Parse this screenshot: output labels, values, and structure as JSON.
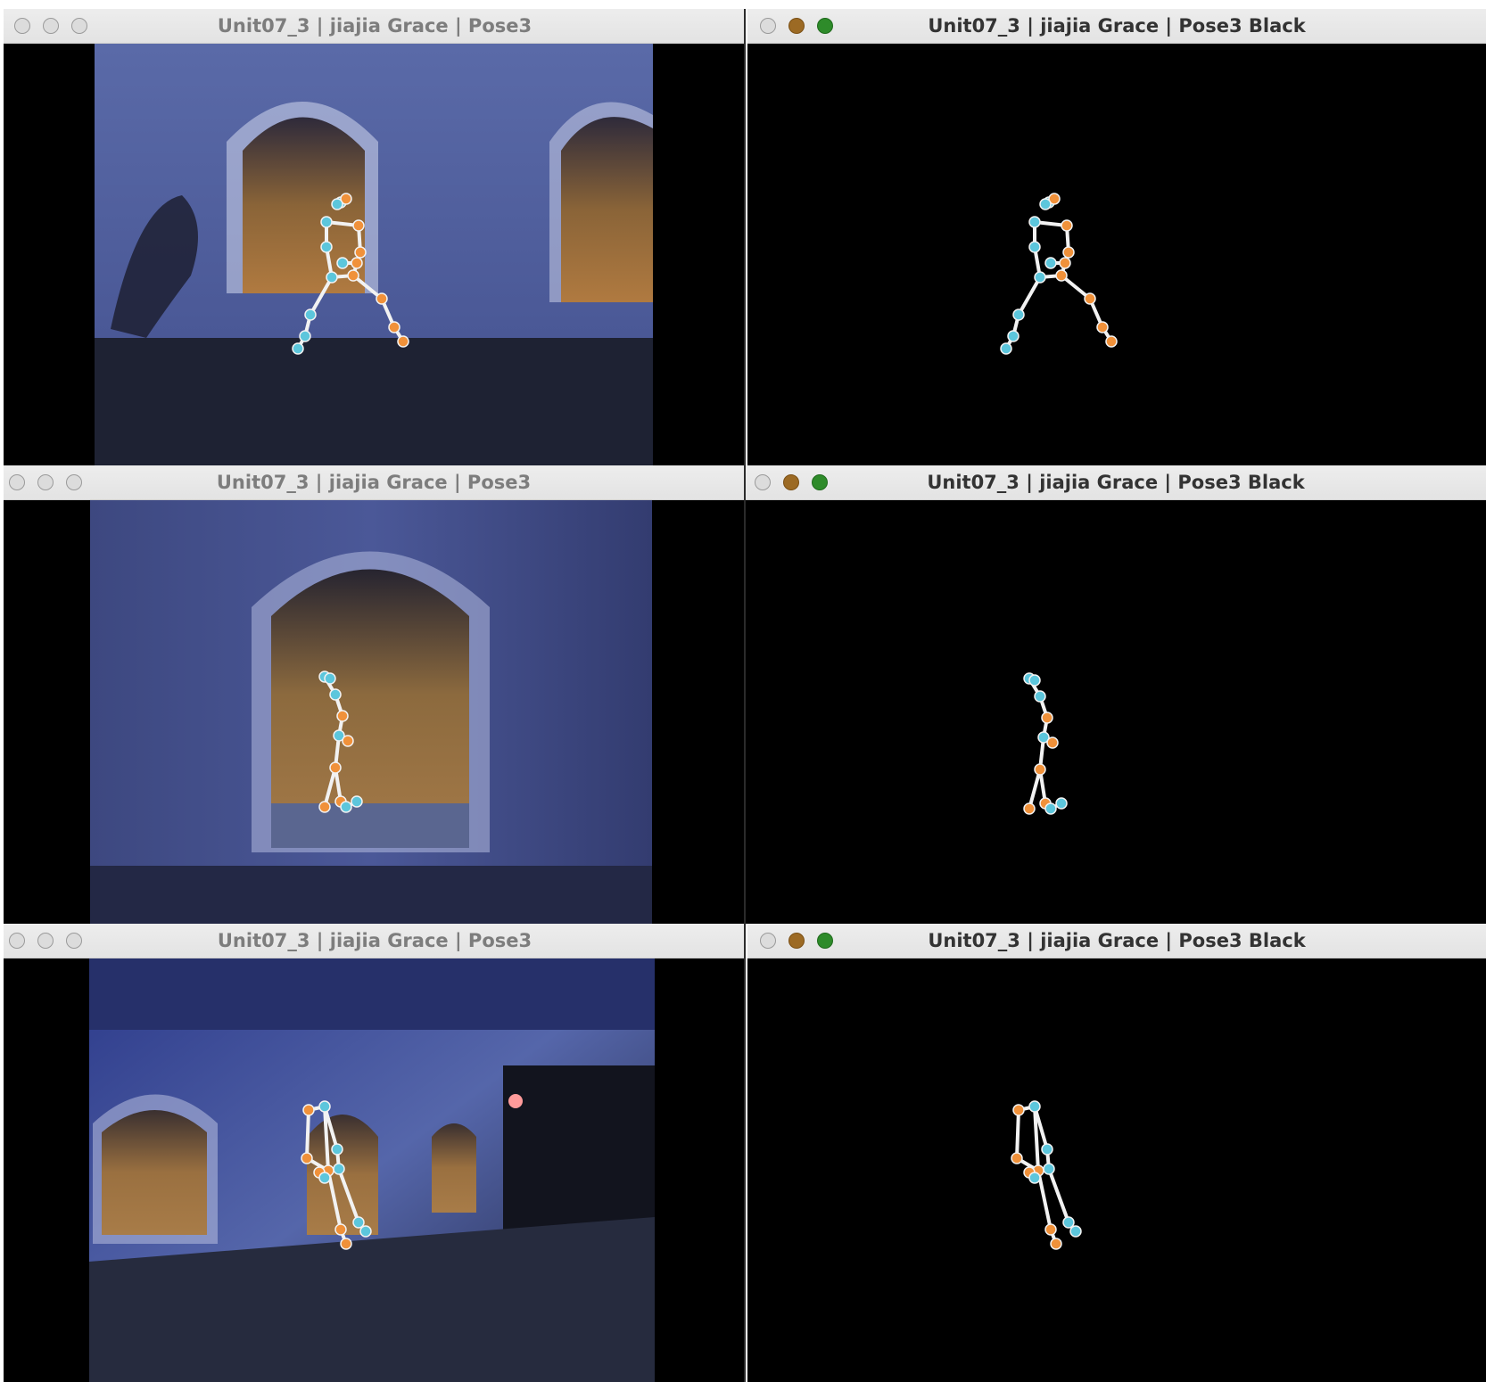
{
  "windows": [
    {
      "title": "Unit07_3 | jiajia Grace | Pose3",
      "active": false
    },
    {
      "title": "Unit07_3 | jiajia Grace | Pose3 Black",
      "active": true
    },
    {
      "title": "Unit07_3 | jiajia Grace | Pose3",
      "active": false
    },
    {
      "title": "Unit07_3 | jiajia Grace | Pose3 Black",
      "active": true
    },
    {
      "title": "Unit07_3 | jiajia Grace | Pose3",
      "active": false
    },
    {
      "title": "Unit07_3 | jiajia Grace | Pose3 Black",
      "active": true
    }
  ],
  "colors": {
    "keypoint_left": "#f0913a",
    "keypoint_right": "#5cc6dc",
    "skeleton_line": "#f2f2f2",
    "background": "#000000"
  },
  "icons": [
    "close-icon",
    "minimize-icon",
    "maximize-icon"
  ]
}
